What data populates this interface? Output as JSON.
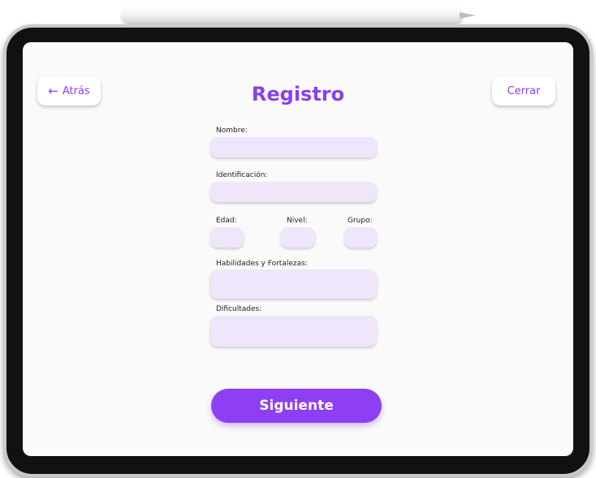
{
  "header": {
    "back_label": "Atrás",
    "back_icon": "arrow-left-icon",
    "title": "Registro",
    "close_label": "Cerrar"
  },
  "form": {
    "nombre_label": "Nombre:",
    "identificacion_label": "Identificación:",
    "edad_label": "Edad:",
    "nivel_label": "Nivel:",
    "grupo_label": "Grupo:",
    "habilidades_label": "Habilidades y Fortalezas:",
    "dificultades_label": "Dificultades:"
  },
  "actions": {
    "next_label": "Siguiente"
  },
  "colors": {
    "accent": "#8e3ff4",
    "field_bg": "#efe6fb",
    "screen_bg": "#fafafa"
  }
}
